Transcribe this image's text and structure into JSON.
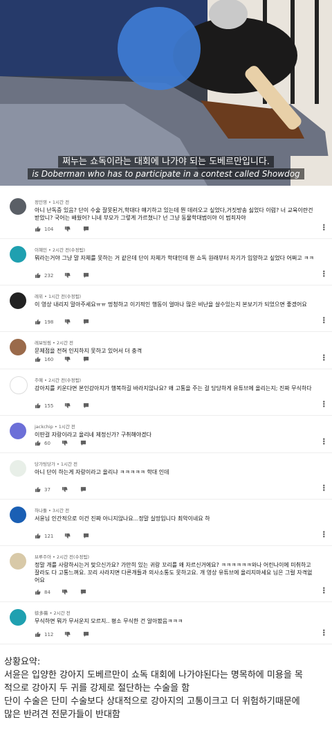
{
  "video": {
    "subtitle_ko": "쩌누는 쇼독이라는 대회에 나가야 되는 도베르만입니다.",
    "subtitle_en": "is Doberman who has to participate in a contest called Showdog"
  },
  "comments": [
    {
      "author": "정민영",
      "time": "1시간 전",
      "text": "아니 난독증 있음? 단이 수술 잘못된거,학대다 얘기하고 있는데 뭔 데려오고 싶었다,거짓방송 싫었다 이럼? 너 교육이란건 받았니? 국어는 배웠어? 니네 부모가 그렇게 가르쳤니? 넌 그냥 동물학대범이야 이 범죄자야",
      "likes": "104",
      "avatar_color": "#5a5f66"
    },
    {
      "author": "이혜인",
      "time": "2시간 전(수정됨)",
      "text": "뭐라는거야 그냥 말 자체를 못하는 거 같은데 단이 자체가 학대인데 뭔 쇼독 원래부터 자기가 입양하고 싶었다 어쩌고 ㅋㅋ",
      "likes": "232",
      "avatar_color": "#1fa0b0"
    },
    {
      "author": "레위",
      "time": "1시간 전(수정됨)",
      "text": "이 영상 내리지 말아주세요ㅠㅠ 멍청하고 이기적인 행동이 얼마나 많은 비난을 살수있는지 본보기가 되었으면 좋겠어요",
      "likes": "198",
      "avatar_color": "#222222"
    },
    {
      "author": "레보팅림",
      "time": "2시간 전",
      "text": "문제점을 전혀 인지하지 못하고 있어서 더 충격",
      "likes": "160",
      "avatar_color": "#9a6a4a"
    },
    {
      "author": "주예",
      "time": "2시간 전(수정됨)",
      "text": "강아지를 키운다면 본인강아지가 행복하길 바라지않나요? 왜 고통을 주는 걸 당당하게 유튜브에 올리는지; 진짜 무식하다",
      "likes": "155",
      "avatar_color": "#ffffff"
    },
    {
      "author": "jackchip",
      "time": "1시간 전",
      "text": "이딴걸 자랑이라고 올리네 제정신가? 구취해야겠다",
      "likes": "60",
      "avatar_color": "#6c6fd8"
    },
    {
      "author": "당가팅당가",
      "time": "1시간 전",
      "text": "아니 단이 하는게 자랑이라고 올리냐 ㅋㅋㅋㅋㅋ 학대 인데",
      "likes": "37",
      "avatar_color": "#e8efe8"
    },
    {
      "author": "하나둘",
      "time": "3시간 전",
      "text": "서윤님 인간적으로 이건 진짜 아니지않나요...정말 실망입니다 최악이네요 하",
      "likes": "121",
      "avatar_color": "#1a5fb4"
    },
    {
      "author": "브루주아",
      "time": "2시간 전(수정됨)",
      "text": "정말 개를 사랑하시는거 맞으신가요? 가만히 있는 귀랑 꼬리를 왜 자르신거에요? ㅋㅋㅋㅋㅋㅋ와나 어린나이에 미취하고 잘라도 다 고통느껴요. 꼬리 사라지면 다른개들과 의사소통도 못하고요. 개 영상 유튜브에 올리지마세요 님은 그럴 자격없어요",
      "likes": "84",
      "avatar_color": "#d8c9a8"
    },
    {
      "author": "徐多薇",
      "time": "2시간 전",
      "text": "무식하면 뭐가 무서운지 모르지.. 평소 무식한 건 알아봤음ㅋㅋㅋ",
      "likes": "112",
      "avatar_color": "#1fa0b0"
    }
  ],
  "summary": {
    "title": "상황요약:",
    "lines": [
      "서윤은 입양한 강아지 도베르만이 쇼독 대회에 나가야된다는 명목하에 미용을 목",
      "적으로 강아지 두 귀를 강제로 절단하는 수술을 함",
      "단이 수술은 단미 수술보다 상대적으로 강아지의 고통이크고 더 위험하기때문에",
      "많은 반려견 전문가들이 반대함"
    ]
  }
}
